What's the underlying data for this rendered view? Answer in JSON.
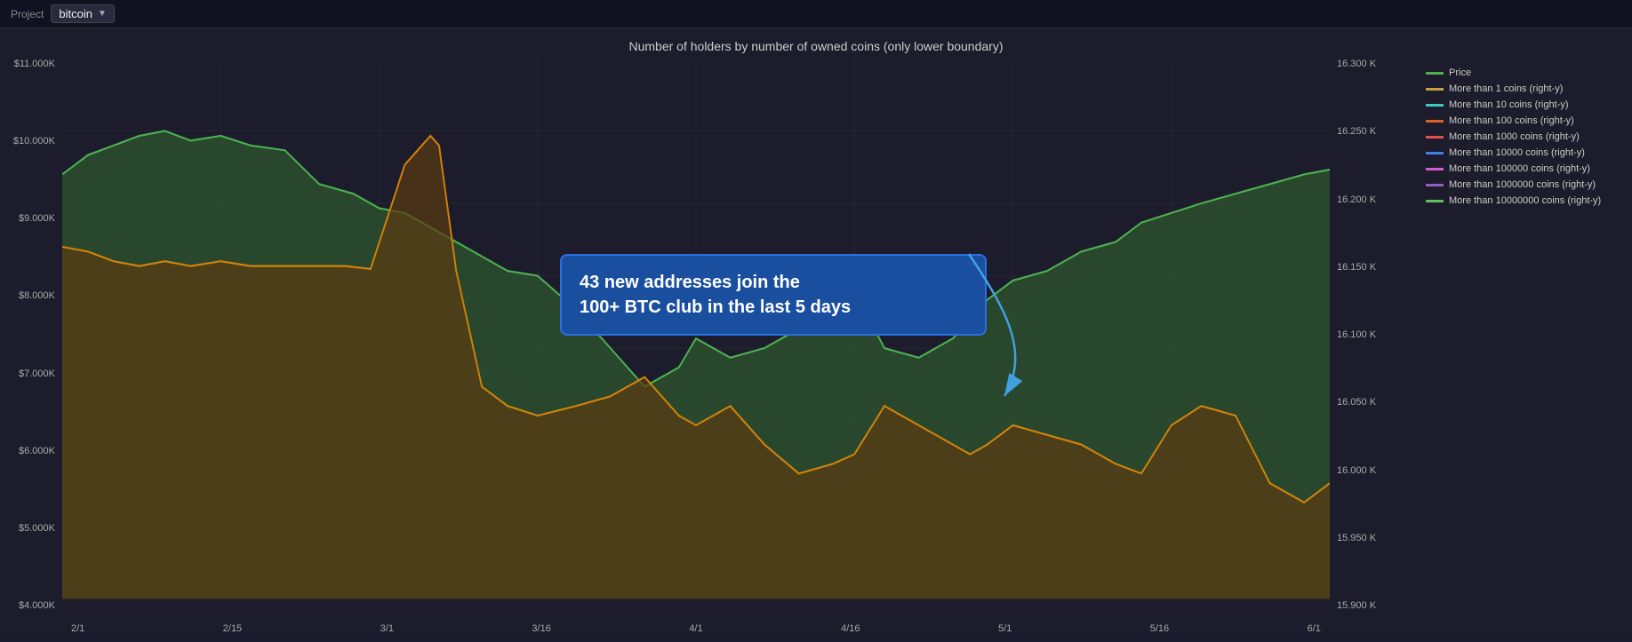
{
  "header": {
    "project_label": "Project",
    "dropdown_value": "bitcoin",
    "dropdown_arrow": "▼"
  },
  "chart": {
    "title": "Number of holders by number of owned coins (only lower boundary)",
    "y_axis_left": [
      "$11.000K",
      "$10.000K",
      "$9.000K",
      "$8.000K",
      "$7.000K",
      "$6.000K",
      "$5.000K",
      "$4.000K"
    ],
    "y_axis_right": [
      "16.300 K",
      "16.250 K",
      "16.200 K",
      "16.150 K",
      "16.100 K",
      "16.050 K",
      "16.000 K",
      "15.950 K",
      "15.900 K"
    ],
    "x_axis": [
      "2/1",
      "2/15",
      "3/1",
      "3/16",
      "4/1",
      "4/16",
      "5/1",
      "5/16",
      "6/1"
    ]
  },
  "annotation": {
    "text": "43 new addresses join the\n100+ BTC club in the last 5 days"
  },
  "legend": {
    "items": [
      {
        "label": "Price",
        "color": "#4caf50"
      },
      {
        "label": "More than 1 coins  (right-y)",
        "color": "#c8a040"
      },
      {
        "label": "More than 10 coins  (right-y)",
        "color": "#40c8c0"
      },
      {
        "label": "More than 100 coins  (right-y)",
        "color": "#e06020"
      },
      {
        "label": "More than 1000 coins  (right-y)",
        "color": "#e05050"
      },
      {
        "label": "More than 10000 coins  (right-y)",
        "color": "#4080e0"
      },
      {
        "label": "More than 100000 coins  (right-y)",
        "color": "#d060d0"
      },
      {
        "label": "More than 1000000 coins  (right-y)",
        "color": "#9060c0"
      },
      {
        "label": "More than 10000000 coins  (right-y)",
        "color": "#60c060"
      }
    ]
  }
}
